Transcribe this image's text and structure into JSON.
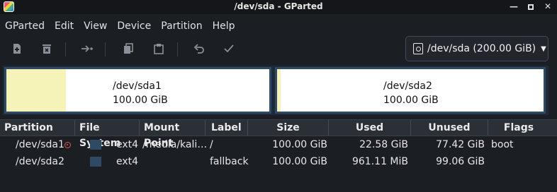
{
  "window": {
    "title": "/dev/sda - GParted"
  },
  "menu": [
    "GParted",
    "Edit",
    "View",
    "Device",
    "Partition",
    "Help"
  ],
  "toolbar": {
    "icons": [
      "new-partition-icon",
      "delete-partition-icon",
      "resize-move-icon",
      "copy-icon",
      "paste-icon",
      "undo-icon",
      "apply-icon"
    ]
  },
  "device_selector": {
    "label": "/dev/sda (200.00 GiB)"
  },
  "disk_map": [
    {
      "name": "/dev/sda1",
      "size": "100.00 GiB",
      "used_fraction": 0.2258
    },
    {
      "name": "/dev/sda2",
      "size": "100.00 GiB",
      "used_fraction": 0.0094
    }
  ],
  "table": {
    "headers": [
      "Partition",
      "File System",
      "Mount Point",
      "Label",
      "Size",
      "Used",
      "Unused",
      "Flags"
    ],
    "rows": [
      {
        "partition": "/dev/sda1",
        "filesystem": "ext4",
        "mount_point": "/media/kali…",
        "label": "/",
        "size": "100.00 GiB",
        "used": "22.58 GiB",
        "unused": "77.42 GiB",
        "flags": "boot",
        "mounted_warning": true
      },
      {
        "partition": "/dev/sda2",
        "filesystem": "ext4",
        "mount_point": "",
        "label": "fallback",
        "size": "100.00 GiB",
        "used": "961.11 MiB",
        "unused": "99.06 GiB",
        "flags": "",
        "mounted_warning": false
      }
    ]
  },
  "colors": {
    "filesystem_ext4": "#2f4a64",
    "used_space": "#f6f3b8",
    "warning": "#e2574c"
  }
}
